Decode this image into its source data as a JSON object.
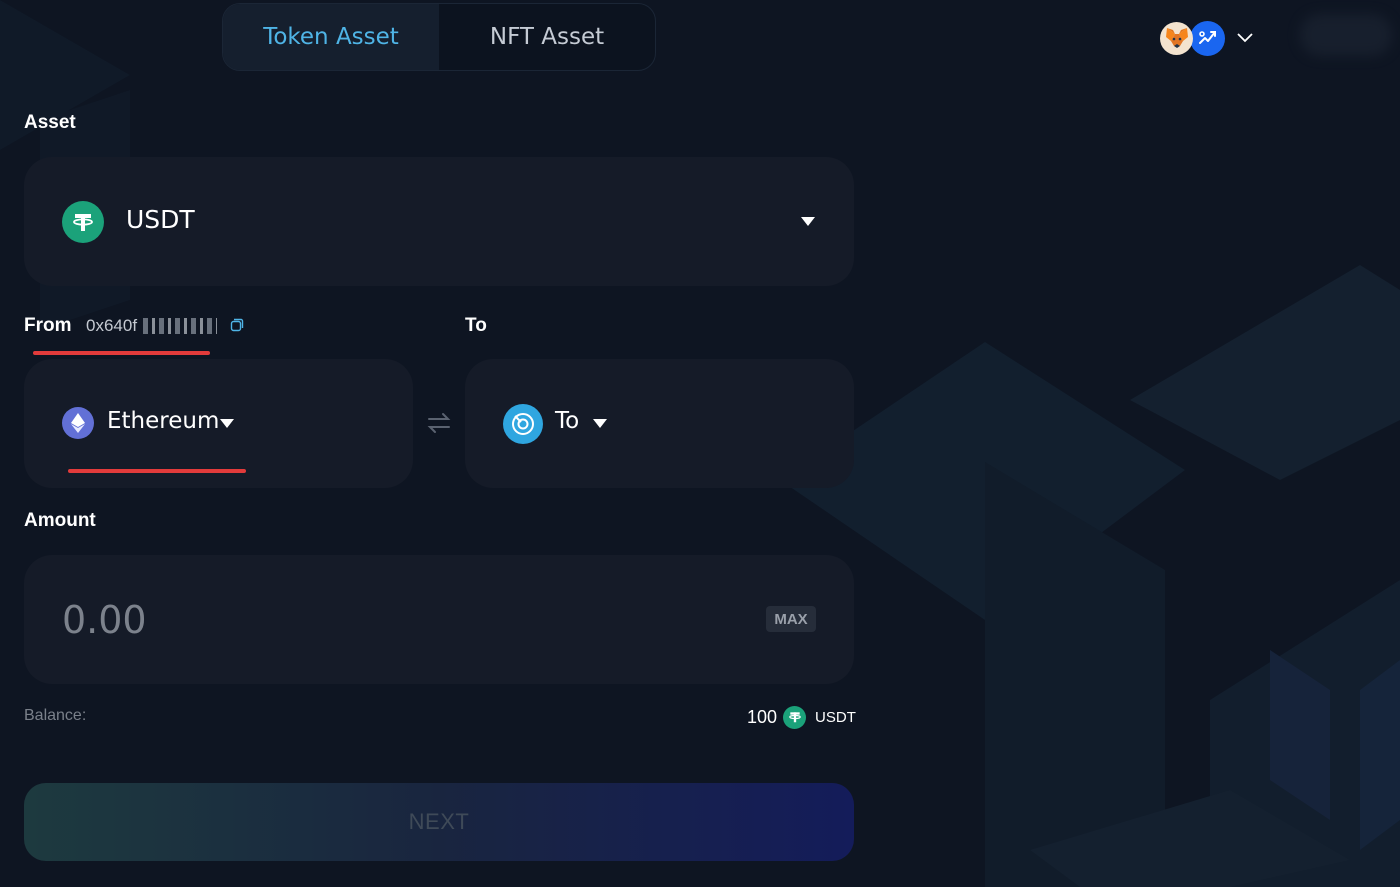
{
  "tabs": [
    {
      "label": "Token Asset",
      "active": true
    },
    {
      "label": "NFT Asset",
      "active": false
    }
  ],
  "header": {
    "wallet_icon": "metamask-fox-icon",
    "network_icon": "network-icon",
    "dropdown_icon": "chevron-down-icon"
  },
  "asset": {
    "label": "Asset",
    "token": "USDT",
    "token_icon": "tether-icon"
  },
  "from": {
    "label": "From",
    "address": "0x640f",
    "address_masked": true,
    "chain": "Ethereum",
    "chain_icon": "ethereum-icon"
  },
  "to": {
    "label": "To",
    "chain": "To",
    "chain_icon": "target-chain-icon"
  },
  "amount": {
    "label": "Amount",
    "placeholder": "0.00",
    "max_label": "MAX"
  },
  "balance": {
    "label": "Balance:",
    "value": "100",
    "symbol": "USDT"
  },
  "next_label": "NEXT",
  "colors": {
    "background": "#0e1522",
    "panel": "#151b28",
    "accent": "#4fb4e6",
    "tether": "#1ba27a",
    "highlight_underline": "#e23b3b"
  }
}
